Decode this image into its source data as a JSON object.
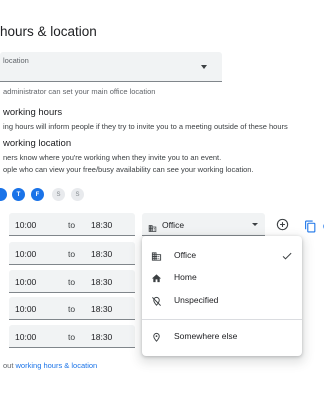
{
  "section": {
    "title": "hours & location"
  },
  "location_select": {
    "label": "location",
    "helper": "administrator can set your main office location"
  },
  "working_hours": {
    "title": "working hours",
    "description": "ing hours will inform people if they try to invite you to a meeting outside of these hours"
  },
  "working_location": {
    "title": "working location",
    "description_1": "ners know where you're working when they invite you to an event.",
    "description_2": "ople who can view your free/busy availability can see your working location."
  },
  "days": [
    {
      "label": "",
      "enabled": true
    },
    {
      "label": "T",
      "enabled": true
    },
    {
      "label": "F",
      "enabled": true
    },
    {
      "label": "S",
      "enabled": false
    },
    {
      "label": "S",
      "enabled": false
    }
  ],
  "time_rows": [
    {
      "start": "10:00",
      "to": "to",
      "end": "18:30"
    },
    {
      "start": "10:00",
      "to": "to",
      "end": "18:30"
    },
    {
      "start": "10:00",
      "to": "to",
      "end": "18:30"
    },
    {
      "start": "10:00",
      "to": "to",
      "end": "18:30"
    },
    {
      "start": "10:00",
      "to": "to",
      "end": "18:30"
    },
    {
      "start": "10:00",
      "to": "to",
      "end": "18:30"
    }
  ],
  "location_field": {
    "value": "Office",
    "icon": "building-icon"
  },
  "location_menu": {
    "items": [
      {
        "label": "Office",
        "icon": "building-icon",
        "selected": true
      },
      {
        "label": "Home",
        "icon": "home-icon",
        "selected": false
      },
      {
        "label": "Unspecified",
        "icon": "location-off-icon",
        "selected": false
      },
      {
        "label": "Somewhere else",
        "icon": "location-pin-icon",
        "selected": false
      }
    ]
  },
  "footer": {
    "prefix": "out ",
    "link": "working hours & location"
  },
  "colors": {
    "accent": "#1a73e8",
    "field_bg": "#f1f3f4",
    "text": "#202124",
    "muted": "#5f6368"
  }
}
